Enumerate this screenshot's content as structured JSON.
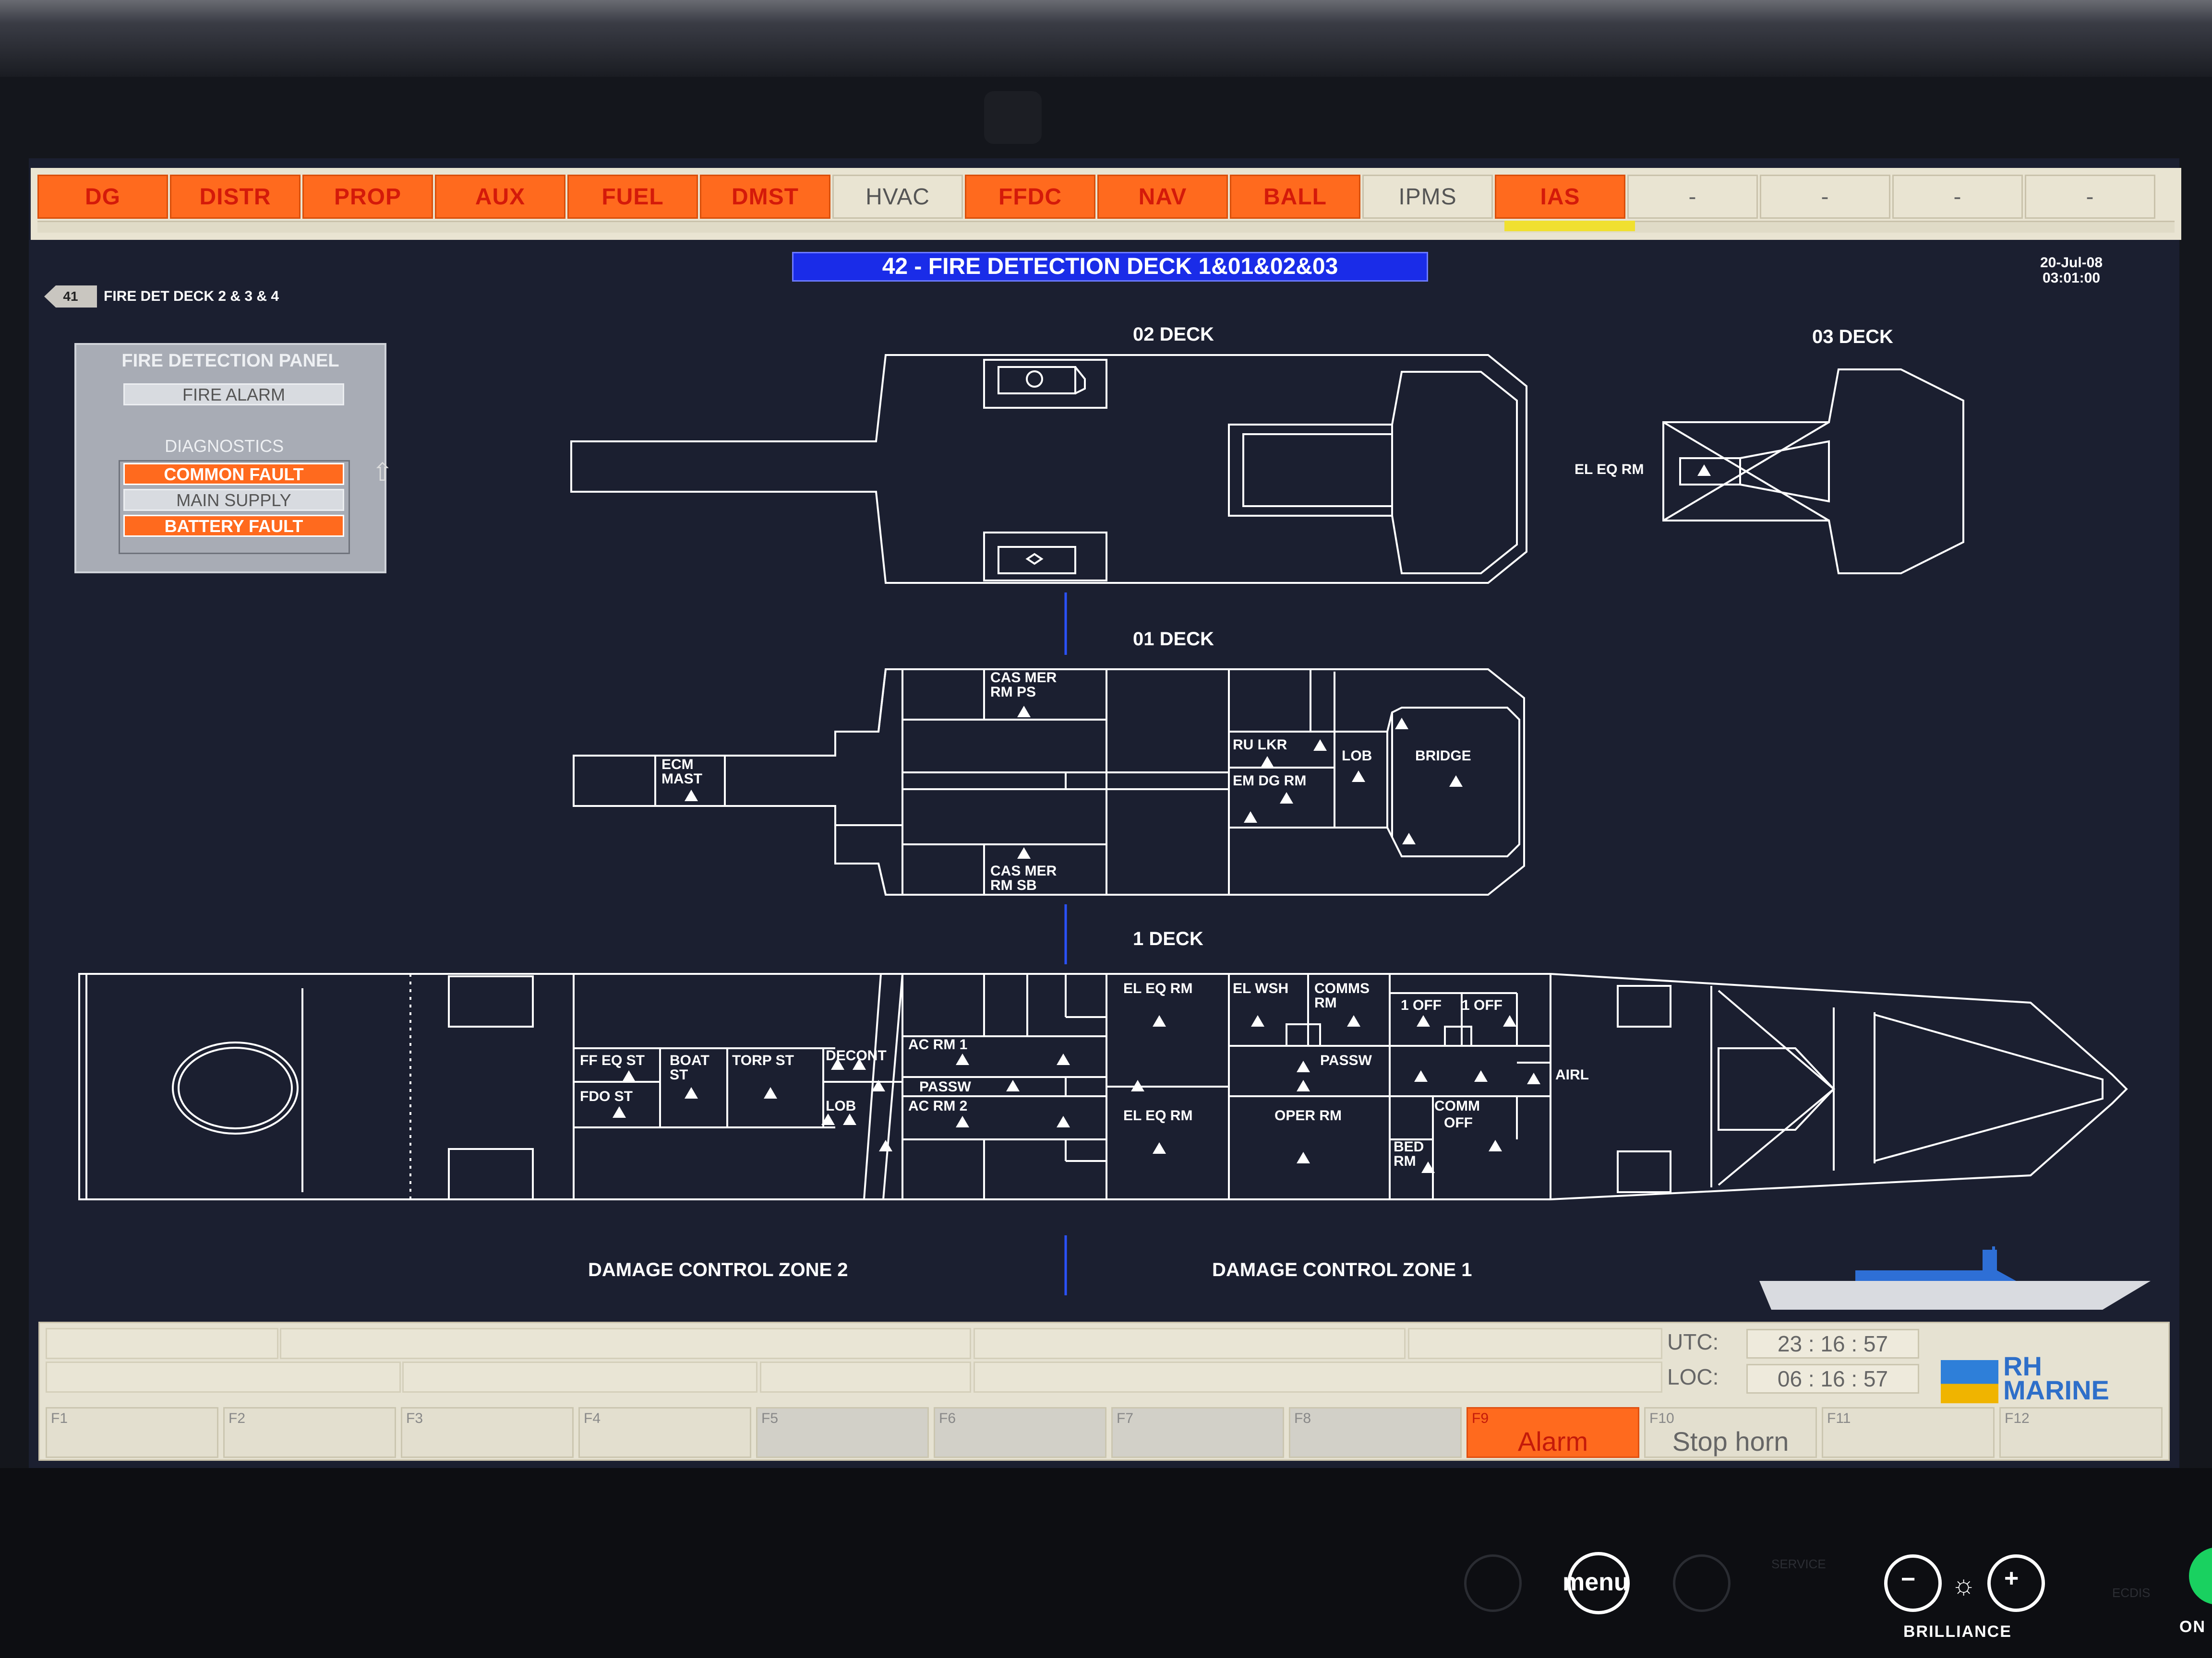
{
  "tabs": [
    {
      "label": "DG",
      "state": "alarm"
    },
    {
      "label": "DISTR",
      "state": "alarm"
    },
    {
      "label": "PROP",
      "state": "alarm"
    },
    {
      "label": "AUX",
      "state": "alarm"
    },
    {
      "label": "FUEL",
      "state": "alarm"
    },
    {
      "label": "DMST",
      "state": "alarm"
    },
    {
      "label": "HVAC",
      "state": "normal"
    },
    {
      "label": "FFDC",
      "state": "alarm"
    },
    {
      "label": "NAV",
      "state": "alarm"
    },
    {
      "label": "BALL",
      "state": "alarm"
    },
    {
      "label": "IPMS",
      "state": "normal"
    },
    {
      "label": "IAS",
      "state": "alarm"
    },
    {
      "label": "-",
      "state": "empty"
    },
    {
      "label": "-",
      "state": "empty"
    },
    {
      "label": "-",
      "state": "empty"
    },
    {
      "label": "-",
      "state": "empty"
    }
  ],
  "page": {
    "title": "42 - FIRE DETECTION DECK 1&01&02&03",
    "date": "20-Jul-08",
    "time": "03:01:00",
    "back_number": "41",
    "back_label": "FIRE DET DECK 2 & 3 & 4"
  },
  "fire_panel": {
    "title": "FIRE DETECTION PANEL",
    "fire_alarm": "FIRE ALARM",
    "diagnostics": "DIAGNOSTICS",
    "common_fault": "COMMON FAULT",
    "main_supply": "MAIN SUPPLY",
    "battery_fault": "BATTERY FAULT"
  },
  "decks": {
    "deck_02": "02 DECK",
    "deck_03": "03 DECK",
    "deck_01": "01 DECK",
    "deck_1": "1 DECK"
  },
  "rooms": {
    "el_eq_rm_03": "EL EQ RM",
    "cas_mer_ps_1": "CAS MER",
    "cas_mer_ps_2": "RM PS",
    "cas_mer_sb_1": "CAS MER",
    "cas_mer_sb_2": "RM SB",
    "ecm_mast_1": "ECM",
    "ecm_mast_2": "MAST",
    "ru_lkr": "RU LKR",
    "lob_01": "LOB",
    "bridge": "BRIDGE",
    "em_dg_rm": "EM DG RM",
    "ff_eq_st": "FF EQ ST",
    "fdo_st": "FDO ST",
    "boat_st_1": "BOAT",
    "boat_st_2": "ST",
    "torp_st": "TORP ST",
    "decont": "DECONT",
    "lob_1": "LOB",
    "ac_rm_1": "AC RM 1",
    "passw_1": "PASSW",
    "ac_rm_2": "AC RM 2",
    "el_eq_rm_a": "EL EQ RM",
    "el_eq_rm_b": "EL EQ RM",
    "el_wsh": "EL WSH",
    "comms_rm_1": "COMMS",
    "comms_rm_2": "RM",
    "off_1a": "1 OFF",
    "off_1b": "1 OFF",
    "passw_2": "PASSW",
    "airl": "AIRL",
    "oper_rm": "OPER RM",
    "comm_off_1": "COMM",
    "comm_off_2": "OFF",
    "bed_rm_1": "BED",
    "bed_rm_2": "RM"
  },
  "zones": {
    "zone2": "DAMAGE CONTROL ZONE 2",
    "zone1": "DAMAGE CONTROL ZONE 1"
  },
  "clock": {
    "utc_label": "UTC:",
    "utc": "23 : 16 : 57",
    "loc_label": "LOC:",
    "loc": "06 : 16 : 57"
  },
  "logo": {
    "line1": "RH",
    "line2": "MARINE"
  },
  "fkeys": [
    {
      "num": "F1",
      "label": ""
    },
    {
      "num": "F2",
      "label": ""
    },
    {
      "num": "F3",
      "label": ""
    },
    {
      "num": "F4",
      "label": ""
    },
    {
      "num": "F5",
      "label": ""
    },
    {
      "num": "F6",
      "label": ""
    },
    {
      "num": "F7",
      "label": ""
    },
    {
      "num": "F8",
      "label": ""
    },
    {
      "num": "F9",
      "label": "Alarm"
    },
    {
      "num": "F10",
      "label": "Stop horn"
    },
    {
      "num": "F11",
      "label": ""
    },
    {
      "num": "F12",
      "label": ""
    }
  ],
  "hardware": {
    "menu": "menu",
    "brilliance": "BRILLIANCE",
    "service": "SERVICE",
    "ecdis": "ECDIS",
    "on": "ON"
  },
  "colors": {
    "alarm_tab": "#ff6a1e",
    "alarm_text": "#d41a0a",
    "title_bar": "#1a2ce8",
    "screen_bg": "#1b1f30",
    "line": "#ffffff"
  }
}
